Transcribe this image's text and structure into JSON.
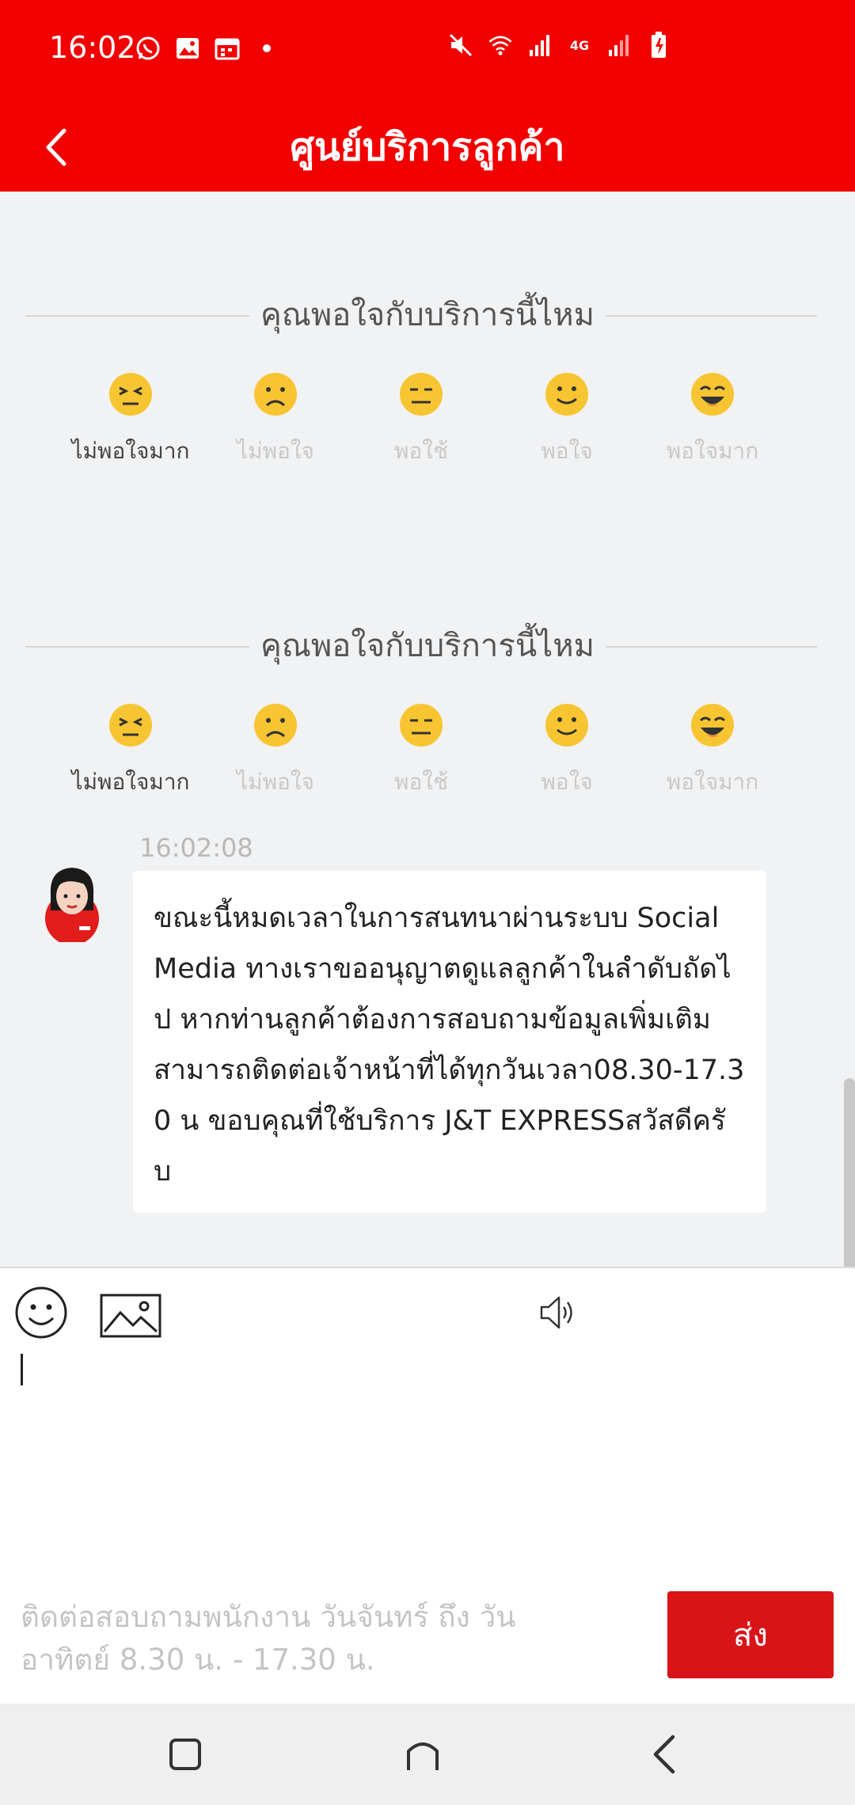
{
  "status_bar": {
    "time": "16:02",
    "left_icons": [
      "whatsapp-icon",
      "gallery-icon",
      "calendar-icon",
      "dot-icon"
    ],
    "right_icons": [
      "mute-icon",
      "wifi-icon",
      "signal-icon",
      "4g-signal-icon",
      "signal-icon-2",
      "battery-icon"
    ],
    "network_label": "4G"
  },
  "header": {
    "title": "ศูนย์บริการลูกค้า",
    "background_color": "#f20000"
  },
  "chat": {
    "rating_blocks": [
      {
        "question": "คุณพอใจกับบริการนี้ไหม",
        "selected_index": 0,
        "options": [
          {
            "label": "ไม่พอใจมาก",
            "icon": "angry-face-icon"
          },
          {
            "label": "ไม่พอใจ",
            "icon": "frown-face-icon"
          },
          {
            "label": "พอใช้",
            "icon": "neutral-face-icon"
          },
          {
            "label": "พอใจ",
            "icon": "smile-face-icon"
          },
          {
            "label": "พอใจมาก",
            "icon": "grin-face-icon"
          }
        ]
      },
      {
        "question": "คุณพอใจกับบริการนี้ไหม",
        "selected_index": 0,
        "options": [
          {
            "label": "ไม่พอใจมาก",
            "icon": "angry-face-icon"
          },
          {
            "label": "ไม่พอใจ",
            "icon": "frown-face-icon"
          },
          {
            "label": "พอใช้",
            "icon": "neutral-face-icon"
          },
          {
            "label": "พอใจ",
            "icon": "smile-face-icon"
          },
          {
            "label": "พอใจมาก",
            "icon": "grin-face-icon"
          }
        ]
      }
    ],
    "message": {
      "time": "16:02:08",
      "lines": [
        "ขณะนี้หมดเวลาในการสนทนาผ่านระบบ Social",
        "Media ทางเราขออนุญาตดูแลลูกค้าในลำดับถัดไ",
        "ป หากท่านลูกค้าต้องการสอบถามข้อมูลเพิ่มเติม",
        "สามารถติดต่อเจ้าหน้าที่ได้ทุกวันเวลา08.30-17.3",
        "0 น ขอบคุณที่ใช้บริการ J&T EXPRESSสวัสดีครั",
        "บ"
      ]
    }
  },
  "input": {
    "value": "",
    "hours_line1": "ติดต่อสอบถามพนักงาน วันจันทร์ ถึง วัน",
    "hours_line2": "อาทิตย์ 8.30 น. - 17.30 น.",
    "send_label": "ส่ง",
    "send_color": "#d81418"
  },
  "colors": {
    "accent": "#f20000",
    "emoji_yellow": "#f7c531",
    "chat_background": "#f1f2f4"
  }
}
